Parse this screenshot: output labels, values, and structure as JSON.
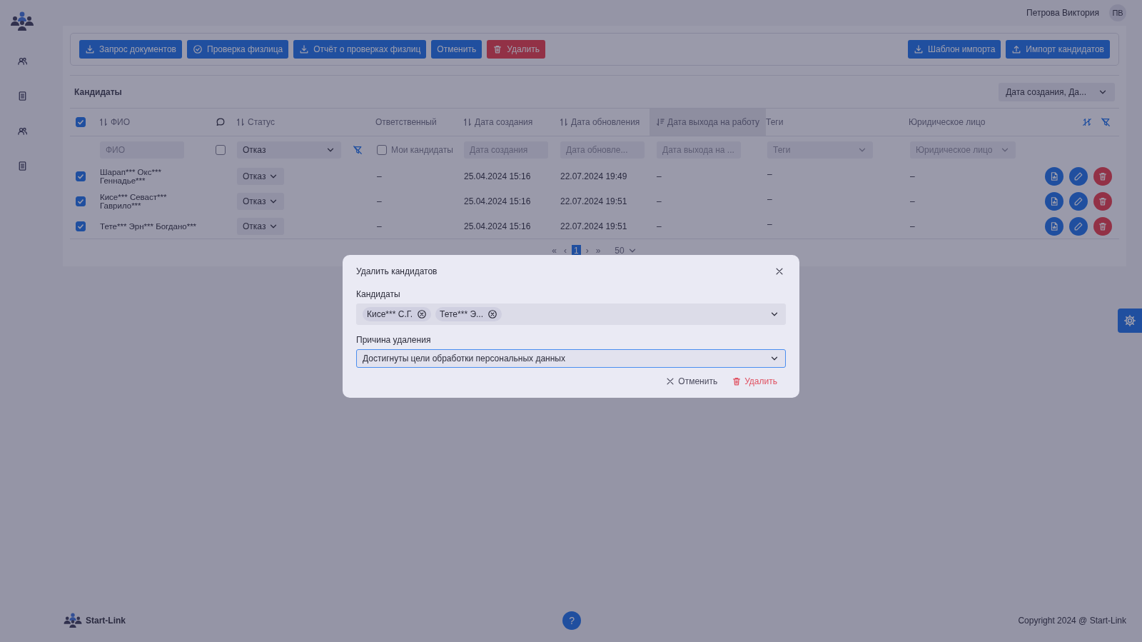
{
  "user": {
    "name": "Петрова Виктория",
    "initials": "ПВ"
  },
  "sidebar": {
    "items": [
      {
        "kind": "people"
      },
      {
        "kind": "document"
      },
      {
        "kind": "people"
      },
      {
        "kind": "document"
      }
    ]
  },
  "toolbar": {
    "left": [
      {
        "label": "Запрос документов",
        "kind": "primary"
      },
      {
        "label": "Проверка физлица",
        "kind": "primary"
      },
      {
        "label": "Отчёт о проверках физлиц",
        "kind": "primary"
      },
      {
        "label": "Отменить",
        "kind": "primary"
      },
      {
        "label": "Удалить",
        "kind": "danger"
      }
    ],
    "right": [
      {
        "label": "Шаблон импорта",
        "kind": "primary"
      },
      {
        "label": "Импорт кандидатов",
        "kind": "primary"
      }
    ]
  },
  "table": {
    "title": "Кандидаты",
    "sort_select": "Дата создания, Да...",
    "columns": [
      {
        "kind": "check",
        "checked": true
      },
      {
        "kind": "sortable",
        "label": "ФИО",
        "sorted": false,
        "filter": {
          "kind": "text",
          "placeholder": "ФИО"
        }
      },
      {
        "kind": "comment",
        "filter": {
          "kind": "checkbox",
          "checked": false
        }
      },
      {
        "kind": "sortable",
        "label": "Статус",
        "sorted": false,
        "filter": {
          "kind": "select_with_reset",
          "value": "Отказ"
        }
      },
      {
        "kind": "plain",
        "label": "Ответственный",
        "filter": {
          "kind": "checkbox",
          "checked": false,
          "label": "Мои кандидаты"
        }
      },
      {
        "kind": "sortable",
        "label": "Дата создания",
        "sorted": false,
        "filter": {
          "kind": "date",
          "placeholder": "Дата создания"
        }
      },
      {
        "kind": "sortable",
        "label": "Дата обновления",
        "sorted": false,
        "filter": {
          "kind": "date",
          "placeholder": "Дата обновле..."
        }
      },
      {
        "kind": "sortable",
        "label": "Дата выхода на работу",
        "sorted": true,
        "filter": {
          "kind": "date",
          "placeholder": "Дата выхода на ..."
        }
      },
      {
        "kind": "plain",
        "label": "Теги",
        "filter": {
          "kind": "select",
          "placeholder": "Теги"
        }
      },
      {
        "kind": "plain",
        "label": "Юридическое лицо",
        "filter": {
          "kind": "select",
          "placeholder": "Юридическое лицо"
        }
      }
    ],
    "rows": [
      {
        "checked": true,
        "name": [
          "Шарап*** Окс***",
          "Геннадье***"
        ],
        "status": "Отказ",
        "responsible": "–",
        "created": "25.04.2024 15:16",
        "updated": "22.07.2024 19:49",
        "start": "–",
        "tags": "–",
        "legal": "–"
      },
      {
        "checked": true,
        "name": [
          "Кисе*** Севаст***",
          "Гаврило***"
        ],
        "status": "Отказ",
        "responsible": "–",
        "created": "25.04.2024 15:16",
        "updated": "22.07.2024 19:51",
        "start": "–",
        "tags": "–",
        "legal": "–"
      },
      {
        "checked": true,
        "name": [
          "Тете*** Эрн*** Богдано***"
        ],
        "status": "Отказ",
        "responsible": "–",
        "created": "25.04.2024 15:16",
        "updated": "22.07.2024 19:51",
        "start": "–",
        "tags": "–",
        "legal": "–"
      }
    ],
    "pagination": {
      "prev": [
        "«",
        "‹"
      ],
      "pages": [
        {
          "label": "1",
          "selected": true
        }
      ],
      "next": [
        "›",
        "»"
      ],
      "page_size": "50"
    }
  },
  "dialog": {
    "title": "Удалить кандидатов",
    "fields": [
      {
        "kind": "tags",
        "label": "Кандидаты",
        "tags": [
          "Кисе*** С.Г.",
          "Тете*** Э..."
        ]
      },
      {
        "kind": "select",
        "label": "Причина удаления",
        "value": "Достигнуты цели обработки персональных данных",
        "focused": true
      }
    ],
    "buttons": [
      {
        "label": "Отменить",
        "kind": "cancel"
      },
      {
        "label": "Удалить",
        "kind": "danger"
      }
    ]
  },
  "footer": {
    "brand": "Start-Link",
    "help": "?",
    "copyright": "Copyright 2024 @ Start-Link"
  }
}
